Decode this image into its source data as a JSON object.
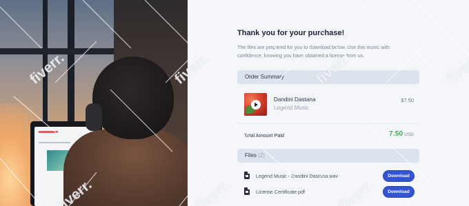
{
  "page": {
    "title": "Thank you for your purchase!",
    "subtitle": "The files are prepared for you to download below. Use this music with confidence, knowing you have obtained a license from us."
  },
  "order_summary": {
    "header": "Order Summary",
    "item": {
      "title": "Dandini Dastana",
      "artist": "Legend Music",
      "price": "$7.50",
      "art_icon": "album-art"
    },
    "total_label": "Total Amount Paid",
    "total_amount": "7.50",
    "total_currency": "USD"
  },
  "files": {
    "header": "Files",
    "count": "(2)",
    "items": [
      {
        "name": "Legend Music - Dandini Dastana.wav",
        "icon": "audio-file-icon",
        "button": "Download"
      },
      {
        "name": "License Certificate.pdf",
        "icon": "pdf-file-icon",
        "button": "Download"
      }
    ]
  },
  "watermark": "fiverr.",
  "colors": {
    "accent": "#3454d1",
    "total_green": "#39b25b",
    "section_bg": "#dde3ec",
    "page_bg": "#f4f6fa"
  }
}
